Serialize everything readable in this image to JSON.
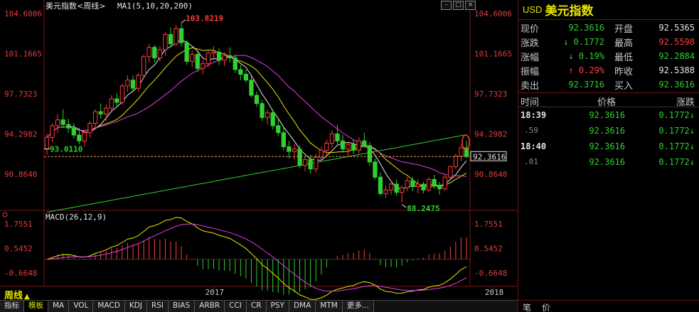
{
  "header": {
    "title": "美元指数<周线>",
    "ma_label": "MA1(5,10,20,200)",
    "macd_label": "MACD(26,12,9)"
  },
  "window_buttons": [
    "-",
    "□",
    "×"
  ],
  "period_button": "周线",
  "bottom_tabs": [
    "指标",
    "模板",
    "MA",
    "VOL",
    "MACD",
    "KDJ",
    "RSI",
    "BIAS",
    "ARBR",
    "CCI",
    "CR",
    "PSY",
    "DMA",
    "MTM",
    "更多..."
  ],
  "side": {
    "code": "USD",
    "name": "美元指数",
    "quotes": [
      {
        "l1": "现价",
        "v1": "92.3616",
        "c1": "green",
        "l2": "开盘",
        "v2": "92.5365",
        "c2": "white"
      },
      {
        "l1": "涨跌",
        "v1": "↓ 0.1772",
        "c1": "green",
        "l2": "最高",
        "v2": "92.5598",
        "c2": "red"
      },
      {
        "l1": "涨幅",
        "v1": "↓ 0.19%",
        "c1": "green",
        "l2": "最低",
        "v2": "92.2884",
        "c2": "green"
      },
      {
        "l1": "振幅",
        "v1": "↑ 0.29%",
        "c1": "red",
        "l2": "昨收",
        "v2": "92.5388",
        "c2": "white"
      },
      {
        "l1": "卖出",
        "v1": "92.3716",
        "c1": "green",
        "l2": "买入",
        "v2": "92.3616",
        "c2": "green"
      }
    ],
    "tick_header": {
      "time": "时间",
      "price": "价格",
      "change": "涨跌"
    },
    "ticks": [
      {
        "time": "18:39",
        "sub": false,
        "price": "92.3616",
        "change": "0.1772↓"
      },
      {
        "time": ".59",
        "sub": true,
        "price": "92.3616",
        "change": "0.1772↓"
      },
      {
        "time": "18:40",
        "sub": false,
        "price": "92.3616",
        "change": "0.1772↓"
      },
      {
        "time": ".01",
        "sub": true,
        "price": "92.3616",
        "change": "0.1772↓"
      }
    ],
    "bottom": {
      "left": "笔",
      "right": "价"
    }
  },
  "chart_data": {
    "type": "candlestick",
    "title": "美元指数<周线>",
    "price_axis_ticks": [
      104.6006,
      101.1665,
      97.7323,
      94.2982,
      90.864
    ],
    "price_ylim": [
      88.0,
      104.9
    ],
    "annotations": {
      "high": {
        "label": "103.8219",
        "value": 103.8219
      },
      "low": {
        "label": "88.2475",
        "value": 88.2475
      },
      "left": {
        "label": "93.0110",
        "value": 93.011
      },
      "current": {
        "label": "92.3616",
        "value": 92.3616
      }
    },
    "x_labels": [
      {
        "label": "2017",
        "index": 31
      },
      {
        "label": "2018",
        "index": 83
      }
    ],
    "candles": [
      [
        93.0,
        94.3,
        92.5,
        94.0
      ],
      [
        94.0,
        95.2,
        93.6,
        95.0
      ],
      [
        95.0,
        96.0,
        94.4,
        95.5
      ],
      [
        95.5,
        96.4,
        94.8,
        95.1
      ],
      [
        95.1,
        95.6,
        94.4,
        94.8
      ],
      [
        94.8,
        95.2,
        93.9,
        94.2
      ],
      [
        94.2,
        94.8,
        93.4,
        93.7
      ],
      [
        93.7,
        94.6,
        93.2,
        94.4
      ],
      [
        94.4,
        95.4,
        94.0,
        95.2
      ],
      [
        95.2,
        96.4,
        94.7,
        96.2
      ],
      [
        96.2,
        96.9,
        95.6,
        96.0
      ],
      [
        96.0,
        96.8,
        95.4,
        96.5
      ],
      [
        96.5,
        97.6,
        96.1,
        97.3
      ],
      [
        97.3,
        97.8,
        96.6,
        97.0
      ],
      [
        97.0,
        98.6,
        96.8,
        98.4
      ],
      [
        98.4,
        99.3,
        97.9,
        98.9
      ],
      [
        98.9,
        99.3,
        98.0,
        98.2
      ],
      [
        98.2,
        99.5,
        97.9,
        99.3
      ],
      [
        99.3,
        101.1,
        99.0,
        100.9
      ],
      [
        100.9,
        102.0,
        100.4,
        101.7
      ],
      [
        101.7,
        101.9,
        100.4,
        100.8
      ],
      [
        100.8,
        101.8,
        100.5,
        101.5
      ],
      [
        101.5,
        103.0,
        101.0,
        102.8
      ],
      [
        102.8,
        103.4,
        101.7,
        102.0
      ],
      [
        102.0,
        103.6,
        101.8,
        103.3
      ],
      [
        103.3,
        103.8,
        101.8,
        102.1
      ],
      [
        102.1,
        102.3,
        100.2,
        100.5
      ],
      [
        100.5,
        101.4,
        100.0,
        101.1
      ],
      [
        101.1,
        101.3,
        99.6,
        99.9
      ],
      [
        99.9,
        100.6,
        99.4,
        100.3
      ],
      [
        100.3,
        101.5,
        100.0,
        101.2
      ],
      [
        101.2,
        101.8,
        100.6,
        101.3
      ],
      [
        101.3,
        101.6,
        100.2,
        100.6
      ],
      [
        100.6,
        101.3,
        100.1,
        101.0
      ],
      [
        101.0,
        101.7,
        100.4,
        100.8
      ],
      [
        100.8,
        101.1,
        99.5,
        99.8
      ],
      [
        99.8,
        100.2,
        98.9,
        99.4
      ],
      [
        99.4,
        99.8,
        98.7,
        98.9
      ],
      [
        98.9,
        99.3,
        97.4,
        97.6
      ],
      [
        97.6,
        97.9,
        96.6,
        96.9
      ],
      [
        96.9,
        97.2,
        95.4,
        95.7
      ],
      [
        95.7,
        96.4,
        95.1,
        96.1
      ],
      [
        96.1,
        96.4,
        94.7,
        95.0
      ],
      [
        95.0,
        95.7,
        94.1,
        94.4
      ],
      [
        94.4,
        94.9,
        92.9,
        93.2
      ],
      [
        93.2,
        93.7,
        92.2,
        92.8
      ],
      [
        92.8,
        93.4,
        92.1,
        93.0
      ],
      [
        93.0,
        93.3,
        91.4,
        91.6
      ],
      [
        91.6,
        92.4,
        91.1,
        92.1
      ],
      [
        92.1,
        92.5,
        90.9,
        91.3
      ],
      [
        91.3,
        92.6,
        91.0,
        92.3
      ],
      [
        92.3,
        93.2,
        91.9,
        92.9
      ],
      [
        92.9,
        93.8,
        92.5,
        93.5
      ],
      [
        93.5,
        94.6,
        93.1,
        94.3
      ],
      [
        94.3,
        95.1,
        93.4,
        93.7
      ],
      [
        93.7,
        94.2,
        92.7,
        93.0
      ],
      [
        93.0,
        93.6,
        92.4,
        93.4
      ],
      [
        93.4,
        93.8,
        92.6,
        92.9
      ],
      [
        92.9,
        94.0,
        92.6,
        93.7
      ],
      [
        93.7,
        94.4,
        93.1,
        93.3
      ],
      [
        93.3,
        93.6,
        91.6,
        91.9
      ],
      [
        91.9,
        92.2,
        90.4,
        90.6
      ],
      [
        90.6,
        91.0,
        89.0,
        89.2
      ],
      [
        89.2,
        89.9,
        88.8,
        89.5
      ],
      [
        89.5,
        90.3,
        89.1,
        90.0
      ],
      [
        90.0,
        90.4,
        89.0,
        89.3
      ],
      [
        89.3,
        89.9,
        88.4,
        89.7
      ],
      [
        89.7,
        90.6,
        89.4,
        90.3
      ],
      [
        90.3,
        90.6,
        89.4,
        89.8
      ],
      [
        89.8,
        90.4,
        89.2,
        90.0
      ],
      [
        90.0,
        90.2,
        89.2,
        89.5
      ],
      [
        89.5,
        90.6,
        89.3,
        90.4
      ],
      [
        90.4,
        90.8,
        89.6,
        89.9
      ],
      [
        89.9,
        90.2,
        89.1,
        89.6
      ],
      [
        89.6,
        90.8,
        89.4,
        90.6
      ],
      [
        90.6,
        91.6,
        90.4,
        91.5
      ],
      [
        91.5,
        92.6,
        91.3,
        92.4
      ],
      [
        92.4,
        93.4,
        92.0,
        93.1
      ],
      [
        93.1,
        93.7,
        92.2,
        92.4
      ]
    ],
    "ma_series": [
      {
        "name": "MA5",
        "color": "#e8e8e8"
      },
      {
        "name": "MA10",
        "color": "#e8e800"
      },
      {
        "name": "MA20",
        "color": "#e040e0"
      },
      {
        "name": "MA200",
        "color": "#30d030"
      }
    ],
    "macd_axis_ticks": [
      1.7551,
      0.5452,
      -0.6648
    ],
    "macd_ylim": [
      -1.3,
      2.1
    ]
  }
}
